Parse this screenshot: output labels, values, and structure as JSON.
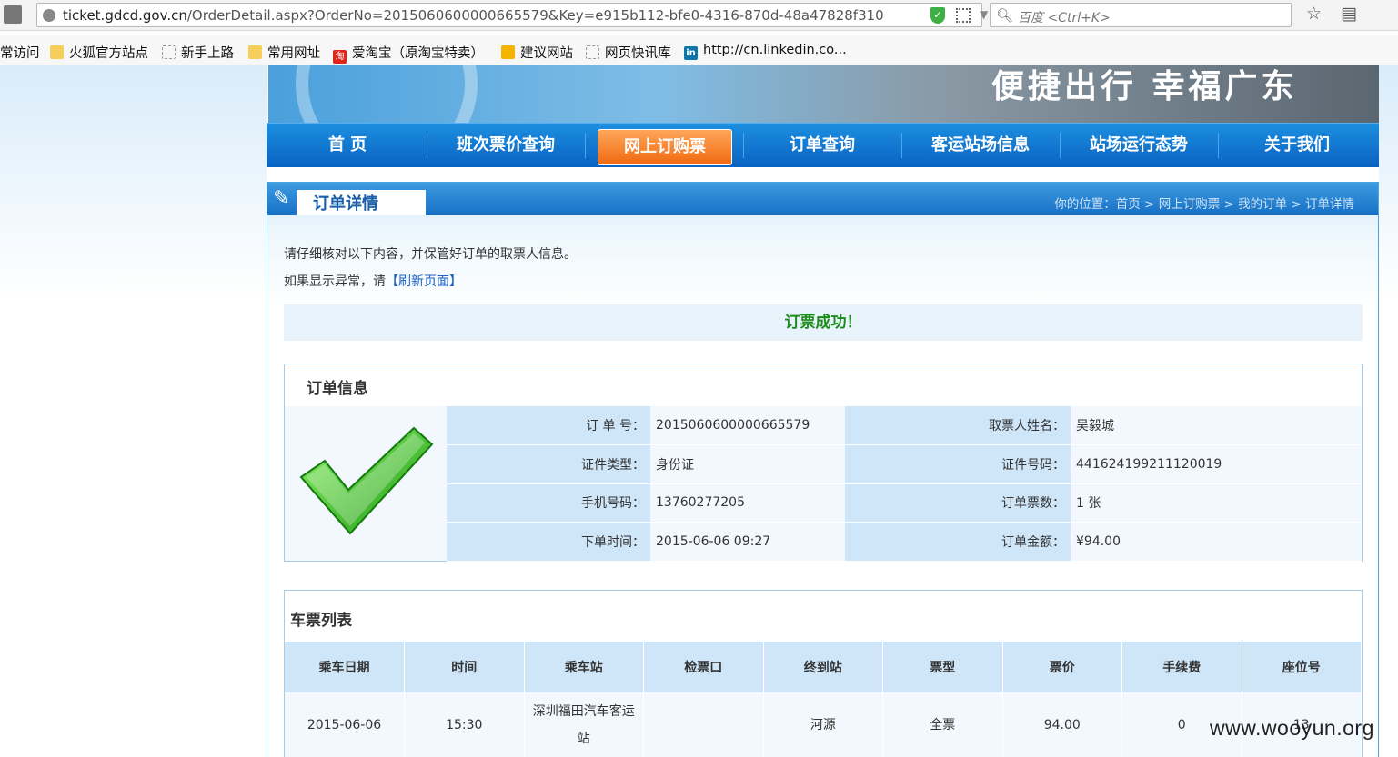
{
  "browser": {
    "url_host": "ticket.gdcd.gov.cn",
    "url_path": "/OrderDetail.aspx?OrderNo=2015060600000665579&Key=e915b112-bfe0-4316-870d-48a47828f310",
    "search_placeholder": "百度 <Ctrl+K>",
    "shield_glyph": "✓",
    "icons": [
      "back-icon",
      "globe-icon",
      "shield-icon",
      "qr-icon",
      "reload-icon",
      "search-icon",
      "star-icon",
      "reader-icon"
    ]
  },
  "bookmarks": [
    {
      "label": "常访问",
      "icon": "none"
    },
    {
      "label": "火狐官方站点",
      "icon": "folder"
    },
    {
      "label": "新手上路",
      "icon": "dotted"
    },
    {
      "label": "常用网址",
      "icon": "folder"
    },
    {
      "label": "爱淘宝（原淘宝特卖）",
      "icon": "taobao",
      "glyph": "淘"
    },
    {
      "label": "建议网站",
      "icon": "bing"
    },
    {
      "label": "网页快讯库",
      "icon": "dotted"
    },
    {
      "label": "http://cn.linkedin.co...",
      "icon": "li",
      "glyph": "in"
    }
  ],
  "banner": {
    "slogan": "便捷出行 幸福广东"
  },
  "nav": {
    "items": [
      "首 页",
      "班次票价查询",
      "网上订购票",
      "订单查询",
      "客运站场信息",
      "站场运行态势",
      "关于我们"
    ],
    "active_index": 2
  },
  "panel": {
    "title": "订单详情",
    "breadcrumb": "你的位置：首页 > 网上订购票 > 我的订单 > 订单详情"
  },
  "notice": {
    "line1": "请仔细核对以下内容，并保管好订单的取票人信息。",
    "line2_prefix": "如果显示异常，请",
    "refresh_link": "【刷新页面】",
    "success": "订票成功！"
  },
  "order_info": {
    "title": "订单信息",
    "rows": [
      {
        "l1": "订 单 号：",
        "v1": "2015060600000665579",
        "l2": "取票人姓名：",
        "v2": "吴毅城"
      },
      {
        "l1": "证件类型：",
        "v1": "身份证",
        "l2": "证件号码：",
        "v2": "441624199211120019"
      },
      {
        "l1": "手机号码：",
        "v1": "13760277205",
        "l2": "订单票数：",
        "v2": "1 张"
      },
      {
        "l1": "下单时间：",
        "v1": "2015-06-06 09:27",
        "l2": "订单金额：",
        "v2": "¥94.00"
      }
    ]
  },
  "tickets": {
    "title": "车票列表",
    "headers": [
      "乘车日期",
      "时间",
      "乘车站",
      "检票口",
      "终到站",
      "票型",
      "票价",
      "手续费",
      "座位号"
    ],
    "rows": [
      [
        "2015-06-06",
        "15:30",
        "深圳福田汽车客运站",
        "",
        "河源",
        "全票",
        "94.00",
        "0",
        "13"
      ]
    ]
  },
  "watermark": "www.wooyun.org",
  "colors": {
    "nav_bg": "#0a62c2",
    "nav_active": "#f06a10",
    "success_text": "#1d8a1d",
    "label_bg": "#cfe6f8"
  }
}
